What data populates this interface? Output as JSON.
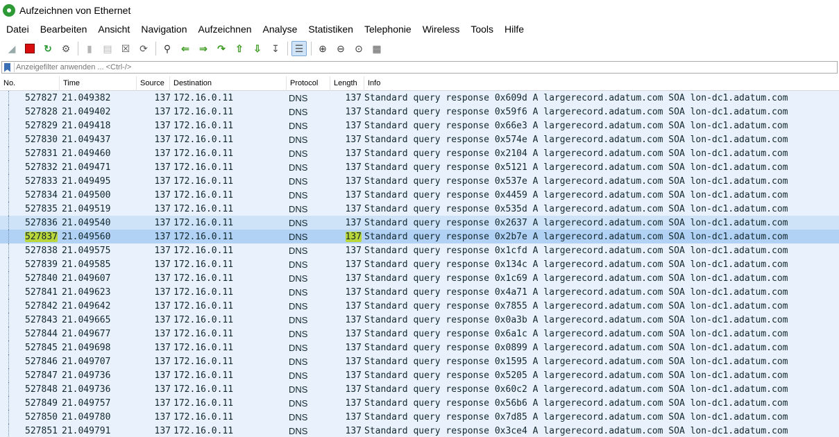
{
  "window": {
    "title": "Aufzeichnen von Ethernet"
  },
  "menu": [
    "Datei",
    "Bearbeiten",
    "Ansicht",
    "Navigation",
    "Aufzeichnen",
    "Analyse",
    "Statistiken",
    "Telephonie",
    "Wireless",
    "Tools",
    "Hilfe"
  ],
  "toolbar": {
    "icons": [
      "shark-fin-icon",
      "stop-icon",
      "restart-icon",
      "options-gear-icon",
      "open-file-icon",
      "save-file-icon",
      "close-file-icon",
      "reload-icon",
      "find-packet-icon",
      "go-back-icon",
      "go-forward-icon",
      "go-to-packet-icon",
      "go-first-icon",
      "go-last-icon",
      "autoscroll-icon",
      "colorize-icon",
      "zoom-in-icon",
      "zoom-out-icon",
      "zoom-normal-icon",
      "resize-columns-icon"
    ]
  },
  "filter": {
    "placeholder": "Anzeigefilter anwenden ... <Ctrl-/>"
  },
  "columns": {
    "no": "No.",
    "time": "Time",
    "source": "Source",
    "destination": "Destination",
    "protocol": "Protocol",
    "length": "Length",
    "info": "Info"
  },
  "highlight_color": "#b9d63a",
  "row_color": "#e8f1fc",
  "selected_row_color": "#b1d2f5",
  "packets": [
    {
      "no": "527827",
      "time": "21.049382",
      "source": "137",
      "destination": "172.16.0.11",
      "protocol": "DNS",
      "length": "137",
      "info": "Standard query response 0x609d A largerecord.adatum.com SOA lon-dc1.adatum.com"
    },
    {
      "no": "527828",
      "time": "21.049402",
      "source": "137",
      "destination": "172.16.0.11",
      "protocol": "DNS",
      "length": "137",
      "info": "Standard query response 0x59f6 A largerecord.adatum.com SOA lon-dc1.adatum.com"
    },
    {
      "no": "527829",
      "time": "21.049418",
      "source": "137",
      "destination": "172.16.0.11",
      "protocol": "DNS",
      "length": "137",
      "info": "Standard query response 0x66e3 A largerecord.adatum.com SOA lon-dc1.adatum.com"
    },
    {
      "no": "527830",
      "time": "21.049437",
      "source": "137",
      "destination": "172.16.0.11",
      "protocol": "DNS",
      "length": "137",
      "info": "Standard query response 0x574e A largerecord.adatum.com SOA lon-dc1.adatum.com"
    },
    {
      "no": "527831",
      "time": "21.049460",
      "source": "137",
      "destination": "172.16.0.11",
      "protocol": "DNS",
      "length": "137",
      "info": "Standard query response 0x2104 A largerecord.adatum.com SOA lon-dc1.adatum.com"
    },
    {
      "no": "527832",
      "time": "21.049471",
      "source": "137",
      "destination": "172.16.0.11",
      "protocol": "DNS",
      "length": "137",
      "info": "Standard query response 0x5121 A largerecord.adatum.com SOA lon-dc1.adatum.com"
    },
    {
      "no": "527833",
      "time": "21.049495",
      "source": "137",
      "destination": "172.16.0.11",
      "protocol": "DNS",
      "length": "137",
      "info": "Standard query response 0x537e A largerecord.adatum.com SOA lon-dc1.adatum.com"
    },
    {
      "no": "527834",
      "time": "21.049500",
      "source": "137",
      "destination": "172.16.0.11",
      "protocol": "DNS",
      "length": "137",
      "info": "Standard query response 0x4459 A largerecord.adatum.com SOA lon-dc1.adatum.com"
    },
    {
      "no": "527835",
      "time": "21.049519",
      "source": "137",
      "destination": "172.16.0.11",
      "protocol": "DNS",
      "length": "137",
      "info": "Standard query response 0x535d A largerecord.adatum.com SOA lon-dc1.adatum.com"
    },
    {
      "no": "527836",
      "time": "21.049540",
      "source": "137",
      "destination": "172.16.0.11",
      "protocol": "DNS",
      "length": "137",
      "info": "Standard query response 0x2637 A largerecord.adatum.com SOA lon-dc1.adatum.com"
    },
    {
      "no": "527837",
      "time": "21.049560",
      "source": "137",
      "destination": "172.16.0.11",
      "protocol": "DNS",
      "length": "137",
      "info": "Standard query response 0x2b7e A largerecord.adatum.com SOA lon-dc1.adatum.com",
      "selected": true
    },
    {
      "no": "527838",
      "time": "21.049575",
      "source": "137",
      "destination": "172.16.0.11",
      "protocol": "DNS",
      "length": "137",
      "info": "Standard query response 0x1cfd A largerecord.adatum.com SOA lon-dc1.adatum.com"
    },
    {
      "no": "527839",
      "time": "21.049585",
      "source": "137",
      "destination": "172.16.0.11",
      "protocol": "DNS",
      "length": "137",
      "info": "Standard query response 0x134c A largerecord.adatum.com SOA lon-dc1.adatum.com"
    },
    {
      "no": "527840",
      "time": "21.049607",
      "source": "137",
      "destination": "172.16.0.11",
      "protocol": "DNS",
      "length": "137",
      "info": "Standard query response 0x1c69 A largerecord.adatum.com SOA lon-dc1.adatum.com"
    },
    {
      "no": "527841",
      "time": "21.049623",
      "source": "137",
      "destination": "172.16.0.11",
      "protocol": "DNS",
      "length": "137",
      "info": "Standard query response 0x4a71 A largerecord.adatum.com SOA lon-dc1.adatum.com"
    },
    {
      "no": "527842",
      "time": "21.049642",
      "source": "137",
      "destination": "172.16.0.11",
      "protocol": "DNS",
      "length": "137",
      "info": "Standard query response 0x7855 A largerecord.adatum.com SOA lon-dc1.adatum.com"
    },
    {
      "no": "527843",
      "time": "21.049665",
      "source": "137",
      "destination": "172.16.0.11",
      "protocol": "DNS",
      "length": "137",
      "info": "Standard query response 0x0a3b A largerecord.adatum.com SOA lon-dc1.adatum.com"
    },
    {
      "no": "527844",
      "time": "21.049677",
      "source": "137",
      "destination": "172.16.0.11",
      "protocol": "DNS",
      "length": "137",
      "info": "Standard query response 0x6a1c A largerecord.adatum.com SOA lon-dc1.adatum.com"
    },
    {
      "no": "527845",
      "time": "21.049698",
      "source": "137",
      "destination": "172.16.0.11",
      "protocol": "DNS",
      "length": "137",
      "info": "Standard query response 0x0899 A largerecord.adatum.com SOA lon-dc1.adatum.com"
    },
    {
      "no": "527846",
      "time": "21.049707",
      "source": "137",
      "destination": "172.16.0.11",
      "protocol": "DNS",
      "length": "137",
      "info": "Standard query response 0x1595 A largerecord.adatum.com SOA lon-dc1.adatum.com"
    },
    {
      "no": "527847",
      "time": "21.049736",
      "source": "137",
      "destination": "172.16.0.11",
      "protocol": "DNS",
      "length": "137",
      "info": "Standard query response 0x5205 A largerecord.adatum.com SOA lon-dc1.adatum.com"
    },
    {
      "no": "527848",
      "time": "21.049736",
      "source": "137",
      "destination": "172.16.0.11",
      "protocol": "DNS",
      "length": "137",
      "info": "Standard query response 0x60c2 A largerecord.adatum.com SOA lon-dc1.adatum.com"
    },
    {
      "no": "527849",
      "time": "21.049757",
      "source": "137",
      "destination": "172.16.0.11",
      "protocol": "DNS",
      "length": "137",
      "info": "Standard query response 0x56b6 A largerecord.adatum.com SOA lon-dc1.adatum.com"
    },
    {
      "no": "527850",
      "time": "21.049780",
      "source": "137",
      "destination": "172.16.0.11",
      "protocol": "DNS",
      "length": "137",
      "info": "Standard query response 0x7d85 A largerecord.adatum.com SOA lon-dc1.adatum.com"
    },
    {
      "no": "527851",
      "time": "21.049791",
      "source": "137",
      "destination": "172.16.0.11",
      "protocol": "DNS",
      "length": "137",
      "info": "Standard query response 0x3ce4 A largerecord.adatum.com SOA lon-dc1.adatum.com"
    }
  ]
}
